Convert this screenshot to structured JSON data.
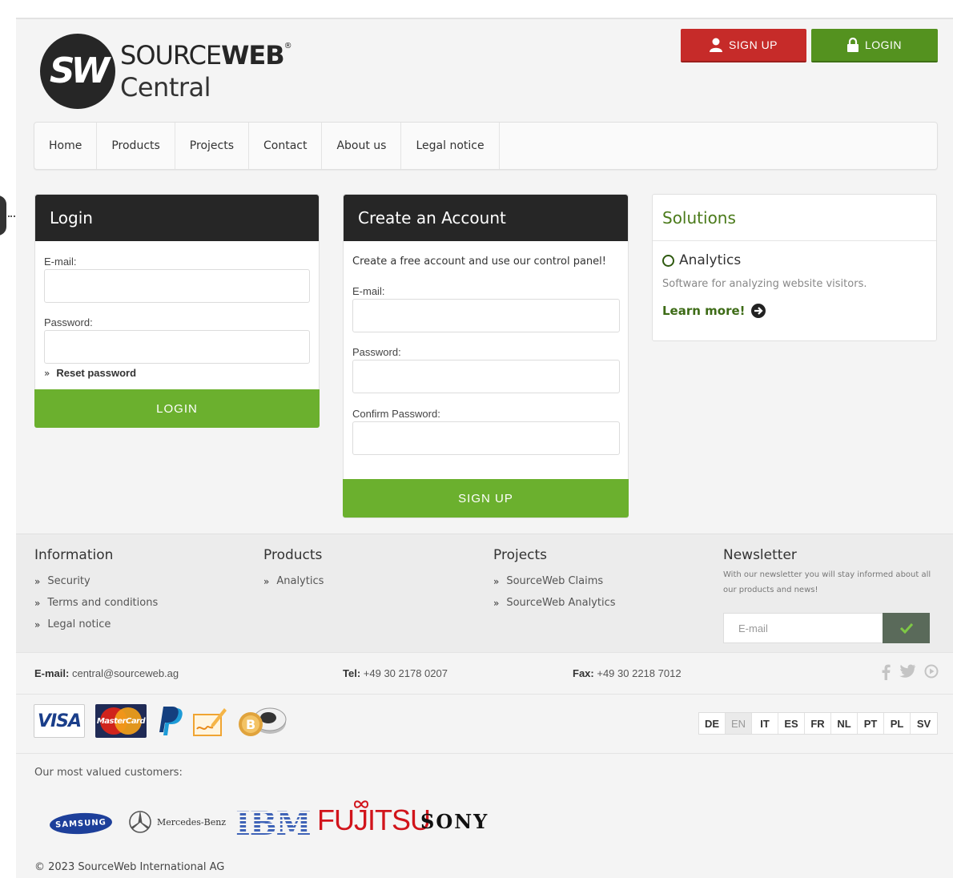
{
  "header": {
    "logo_mark": "SW",
    "brand_part1": "SOURCE",
    "brand_part2": "WEB",
    "brand_reg": "®",
    "brand_sub": "Central",
    "signup_label": "SIGN UP",
    "login_label": "LOGIN",
    "signup_color": "#c62b29",
    "login_color": "#54921f"
  },
  "nav": {
    "items": [
      "Home",
      "Products",
      "Projects",
      "Contact",
      "About us",
      "Legal notice"
    ]
  },
  "login": {
    "title": "Login",
    "email_label": "E-mail:",
    "password_label": "Password:",
    "reset_label": "Reset password",
    "button_label": "LOGIN"
  },
  "account": {
    "title": "Create an Account",
    "intro": "Create a free account and use our control panel!",
    "email_label": "E-mail:",
    "password_label": "Password:",
    "confirm_label": "Confirm Password:",
    "button_label": "SIGN UP"
  },
  "solutions": {
    "title": "Solutions",
    "product_name": "Analytics",
    "product_desc": "Software for analyzing website visitors.",
    "learn_more": "Learn more!"
  },
  "footer": {
    "information": {
      "title": "Information",
      "links": [
        "Security",
        "Terms and conditions",
        "Legal notice"
      ]
    },
    "products": {
      "title": "Products",
      "links": [
        "Analytics"
      ]
    },
    "projects": {
      "title": "Projects",
      "links": [
        "SourceWeb Claims",
        "SourceWeb Analytics"
      ]
    },
    "newsletter": {
      "title": "Newsletter",
      "text": "With our newsletter you will stay informed about all our products and news!",
      "placeholder": "E-mail"
    }
  },
  "contact": {
    "email_label": "E-mail:",
    "email_value": "central@sourceweb.ag",
    "tel_label": "Tel:",
    "tel_value": "+49 30 2178 0207",
    "fax_label": "Fax:",
    "fax_value": "+49 30 2218 7012"
  },
  "payments": {
    "visa": "VISA",
    "mastercard": "MasterCard"
  },
  "languages": {
    "items": [
      "DE",
      "EN",
      "IT",
      "ES",
      "FR",
      "NL",
      "PT",
      "PL",
      "SV"
    ],
    "active": "EN"
  },
  "customers": {
    "title": "Our most valued customers:",
    "samsung": "SAMSUNG",
    "mercedes": "Mercedes-Benz",
    "ibm": "IBM",
    "fujitsu": "FUJITSU",
    "sony": "SONY"
  },
  "copyright": "© 2023 SourceWeb International AG"
}
